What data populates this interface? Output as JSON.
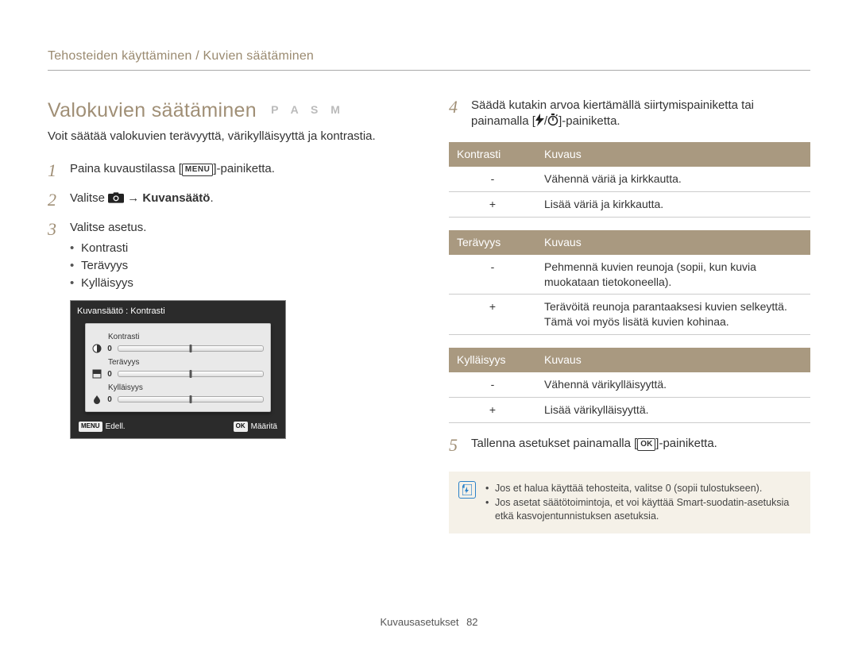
{
  "breadcrumb": "Tehosteiden käyttäminen / Kuvien säätäminen",
  "section_title": "Valokuvien säätäminen",
  "mode_badges": "P A S M",
  "intro": "Voit säätää valokuvien terävyyttä, värikylläisyyttä ja kontrastia.",
  "steps": {
    "s1_a": "Paina kuvaustilassa [",
    "s1_menu": "MENU",
    "s1_b": "]-painiketta.",
    "s2_a": "Valitse ",
    "s2_b": " → ",
    "s2_strong": "Kuvansäätö",
    "s2_c": ".",
    "s3": "Valitse asetus.",
    "s3_items": [
      "Kontrasti",
      "Terävyys",
      "Kylläisyys"
    ],
    "s4_a": "Säädä kutakin arvoa kiertämällä siirtymispainiketta tai painamalla [",
    "s4_b": "/",
    "s4_c": "]-painiketta.",
    "s5_a": "Tallenna asetukset painamalla [",
    "s5_ok": "OK",
    "s5_b": "]-painiketta."
  },
  "screenshot": {
    "title": "Kuvansäätö : Kontrasti",
    "rows": [
      {
        "label": "Kontrasti",
        "value": "0"
      },
      {
        "label": "Terävyys",
        "value": "0"
      },
      {
        "label": "Kylläisyys",
        "value": "0"
      }
    ],
    "back_btn": "MENU",
    "back_label": "Edell.",
    "ok_btn": "OK",
    "ok_label": "Määritä"
  },
  "tables": [
    {
      "head": [
        "Kontrasti",
        "Kuvaus"
      ],
      "rows": [
        [
          "-",
          "Vähennä väriä ja kirkkautta."
        ],
        [
          "+",
          "Lisää väriä ja kirkkautta."
        ]
      ]
    },
    {
      "head": [
        "Terävyys",
        "Kuvaus"
      ],
      "rows": [
        [
          "-",
          "Pehmennä kuvien reunoja (sopii, kun kuvia muokataan tietokoneella)."
        ],
        [
          "+",
          "Terävöitä reunoja parantaaksesi kuvien selkeyttä. Tämä voi myös lisätä kuvien kohinaa."
        ]
      ]
    },
    {
      "head": [
        "Kylläisyys",
        "Kuvaus"
      ],
      "rows": [
        [
          "-",
          "Vähennä värikylläisyyttä."
        ],
        [
          "+",
          "Lisää värikylläisyyttä."
        ]
      ]
    }
  ],
  "note": [
    "Jos et halua käyttää tehosteita, valitse 0 (sopii tulostukseen).",
    "Jos asetat säätötoimintoja, et voi käyttää Smart-suodatin-asetuksia etkä kasvojentunnistuksen asetuksia."
  ],
  "footer_label": "Kuvausasetukset",
  "footer_page": "82"
}
